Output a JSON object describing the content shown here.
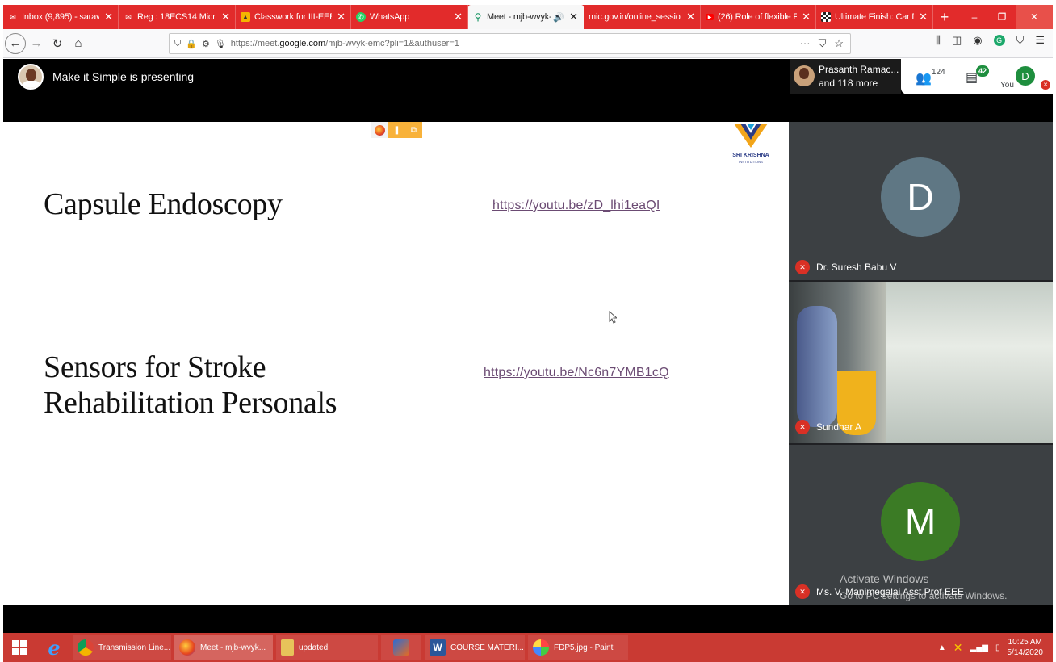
{
  "browser": {
    "tabs": [
      {
        "label": "Inbox (9,895) - saravan",
        "icon": "mail-icon",
        "active": false
      },
      {
        "label": "Reg : 18ECS14 Microc",
        "icon": "mail-icon",
        "active": false
      },
      {
        "label": "Classwork for III-EEE-",
        "icon": "classroom-icon",
        "active": false
      },
      {
        "label": "WhatsApp",
        "icon": "whatsapp-icon",
        "active": false
      },
      {
        "label": "Meet - mjb-wvyk-",
        "icon": "meet-icon",
        "active": true
      },
      {
        "label": "mic.gov.in/online_session",
        "icon": "",
        "active": false
      },
      {
        "label": "(26) Role of flexible FA",
        "icon": "youtube-icon",
        "active": false
      },
      {
        "label": "Ultimate Finish: Car D",
        "icon": "checkered-flag-icon",
        "active": false
      }
    ],
    "new_tab": "+",
    "url_prefix": "https://meet.",
    "url_domain": "google.com",
    "url_rest": "/mjb-wvyk-emc?pli=1&authuser=1"
  },
  "meet": {
    "presenting_text": "Make it Simple is presenting",
    "people_card": {
      "name": "Prasanth Ramac...",
      "more": "and 118 more"
    },
    "people_count": "124",
    "chat_count": "42",
    "you_label": "You",
    "you_initial": "D"
  },
  "slide": {
    "logo_text": "SRI KRISHNA",
    "logo_sub": "INSTITUTIONS",
    "item1_title": "Capsule Endoscopy",
    "item1_link": "https://youtu.be/zD_lhi1eaQI",
    "item2_title_line1": "Sensors for Stroke",
    "item2_title_line2": "Rehabilitation Personals",
    "item2_link": "https://youtu.be/Nc6n7YMB1cQ"
  },
  "participants": [
    {
      "name": "Dr. Suresh Babu V",
      "initial": "D",
      "avatar_color": "#5f7784"
    },
    {
      "name": "Sundhar A",
      "initial": "",
      "avatar_color": ""
    },
    {
      "name": "Ms. V. Manimegalai Asst Prof EEE",
      "initial": "M",
      "avatar_color": "#3b7b25"
    }
  ],
  "watermark": {
    "title": "Activate Windows",
    "subtitle": "Go to PC settings to activate Windows."
  },
  "taskbar": {
    "items": [
      {
        "label": "Transmission Line...",
        "icon": "chrome-icon"
      },
      {
        "label": "Meet - mjb-wvyk...",
        "icon": "firefox-icon"
      },
      {
        "label": "updated",
        "icon": "folder-icon"
      },
      {
        "label": "",
        "icon": "matlab-icon"
      },
      {
        "label": "COURSE MATERI...",
        "icon": "word-icon"
      },
      {
        "label": "FDP5.jpg - Paint",
        "icon": "paint-icon"
      }
    ],
    "time": "10:25 AM",
    "date": "5/14/2020"
  },
  "colors": {
    "tabstrip": "#e22b2b",
    "taskbar": "#c93a33",
    "link": "#6b4b73",
    "meet_green": "#1e8e3e",
    "mic_off_red": "#d93025"
  }
}
